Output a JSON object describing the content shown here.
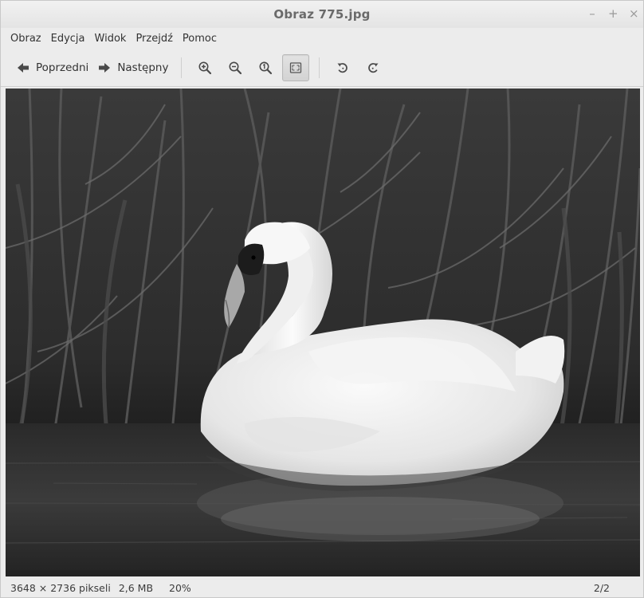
{
  "window": {
    "title": "Obraz 775.jpg",
    "controls": {
      "minimize": "–",
      "maximize": "+",
      "close": "×"
    }
  },
  "menubar": {
    "items": [
      {
        "label": "Obraz"
      },
      {
        "label": "Edycja"
      },
      {
        "label": "Widok"
      },
      {
        "label": "Przejdź"
      },
      {
        "label": "Pomoc"
      }
    ]
  },
  "toolbar": {
    "prev_label": "Poprzedni",
    "next_label": "Następny",
    "icons": {
      "prev": "arrow-left-icon",
      "next": "arrow-right-icon",
      "zoom_in": "zoom-in-icon",
      "zoom_out": "zoom-out-icon",
      "zoom_normal": "zoom-normal-icon",
      "best_fit": "best-fit-icon",
      "rotate_left": "rotate-left-icon",
      "rotate_right": "rotate-right-icon"
    },
    "best_fit_active": true
  },
  "image": {
    "subject": "swan-photo"
  },
  "statusbar": {
    "dimensions": "3648 × 2736 pikseli",
    "filesize": "2,6 MB",
    "zoom": "20%",
    "position": "2/2"
  },
  "colors": {
    "window_bg": "#ececec",
    "viewer_bg": "#2a2a2a",
    "text": "#3c3c3c",
    "title_text": "#6a6a6a"
  }
}
